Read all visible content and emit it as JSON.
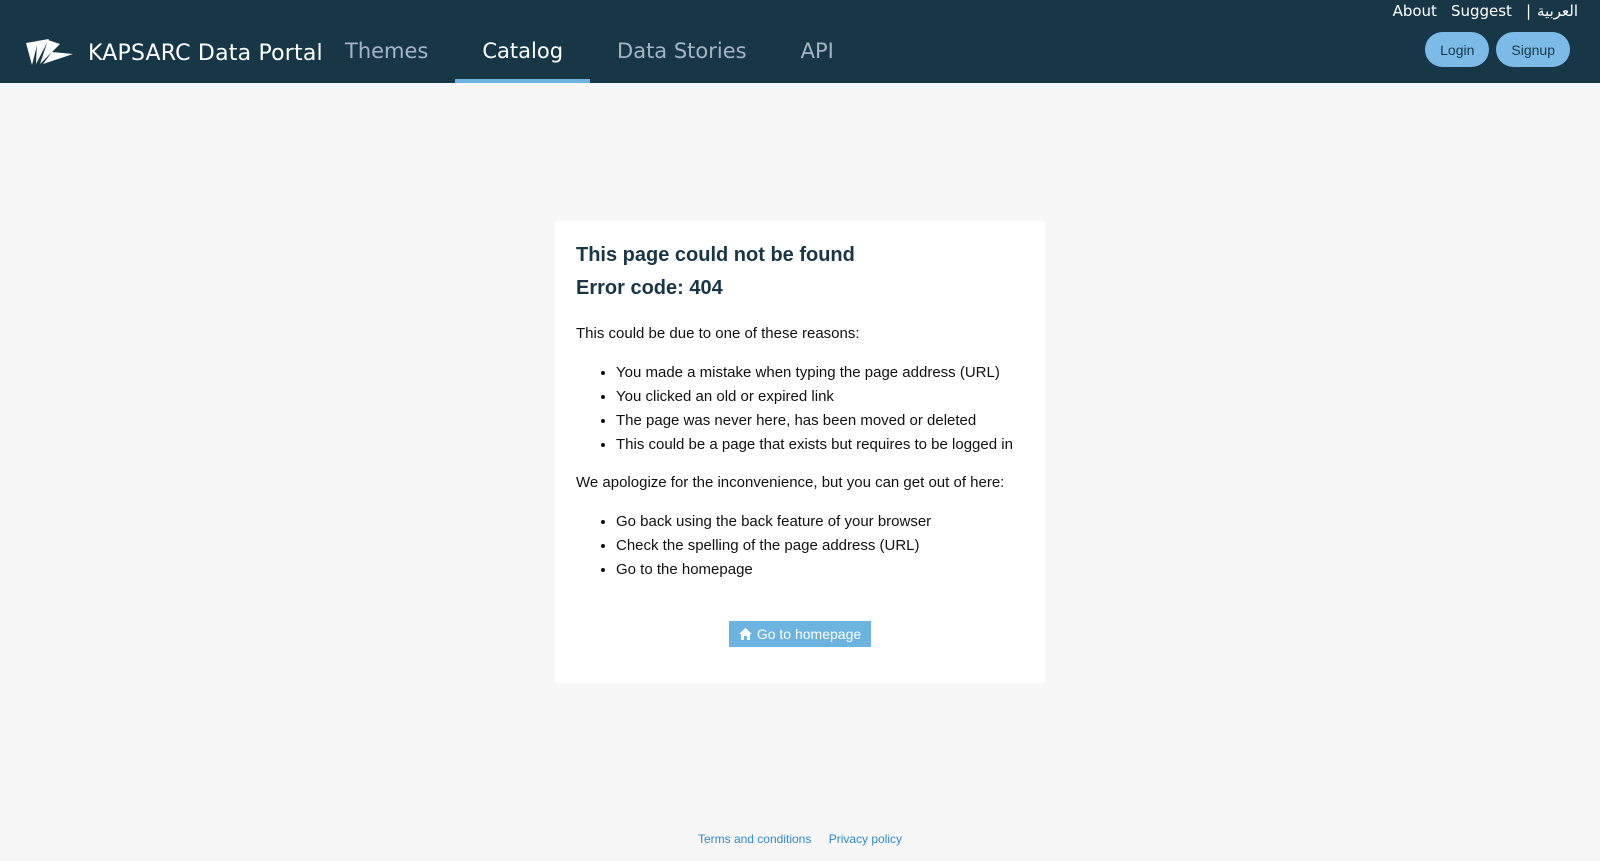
{
  "header": {
    "brand_name": "KAPSARC Data Portal",
    "nav": [
      {
        "label": "Themes",
        "active": false
      },
      {
        "label": "Catalog",
        "active": true
      },
      {
        "label": "Data Stories",
        "active": false
      },
      {
        "label": "API",
        "active": false
      }
    ],
    "top_links": {
      "about": "About",
      "suggest": "Suggest",
      "separator": "|",
      "language": "العربية"
    },
    "login_label": "Login",
    "signup_label": "Signup"
  },
  "error": {
    "title": "This page could not be found",
    "code": "Error code: 404",
    "reasons_intro": "This could be due to one of these reasons:",
    "reasons": [
      "You made a mistake when typing the page address (URL)",
      "You clicked an old or expired link",
      "The page was never here, has been moved or deleted",
      "This could be a page that exists but requires to be logged in"
    ],
    "apology": "We apologize for the inconvenience, but you can get out of here:",
    "options": [
      "Go back using the back feature of your browser",
      "Check the spelling of the page address (URL)",
      "Go to the homepage"
    ],
    "home_button_label": "Go to homepage"
  },
  "footer": {
    "terms": "Terms and conditions",
    "privacy": "Privacy policy"
  },
  "colors": {
    "header_bg": "#173747",
    "accent": "#6cb3e0",
    "button": "#7cbbe8",
    "link": "#2e8bc9"
  },
  "icons": {
    "brand": "kapsarc-logo-icon",
    "home": "home-icon"
  }
}
